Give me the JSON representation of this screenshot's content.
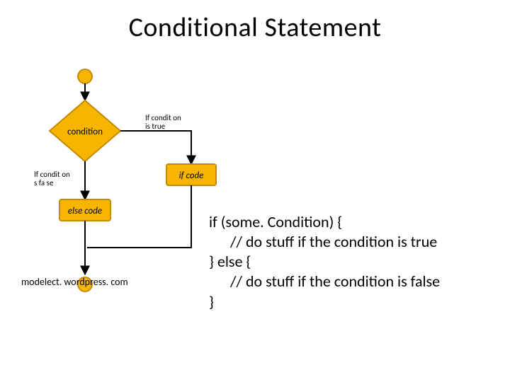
{
  "title": "Conditional Statement",
  "flowchart": {
    "start_shape": "circle",
    "decision_label": "condition",
    "true_branch_label": "If condition is true",
    "false_branch_label": "If condition is false",
    "true_block_label": "if code",
    "false_block_label": "else code",
    "end_shape": "circle",
    "colors": {
      "fill": "#f7b500",
      "stroke": "#c28a00",
      "edge": "#000000",
      "label_text": "#000000"
    }
  },
  "code": {
    "line1": "if (some. Condition) {",
    "line2": "// do stuff if the condition is true",
    "line3": "} else {",
    "line4": "// do stuff if the condition is false",
    "line5": "}"
  },
  "credit": "modelect. wordpress. com"
}
